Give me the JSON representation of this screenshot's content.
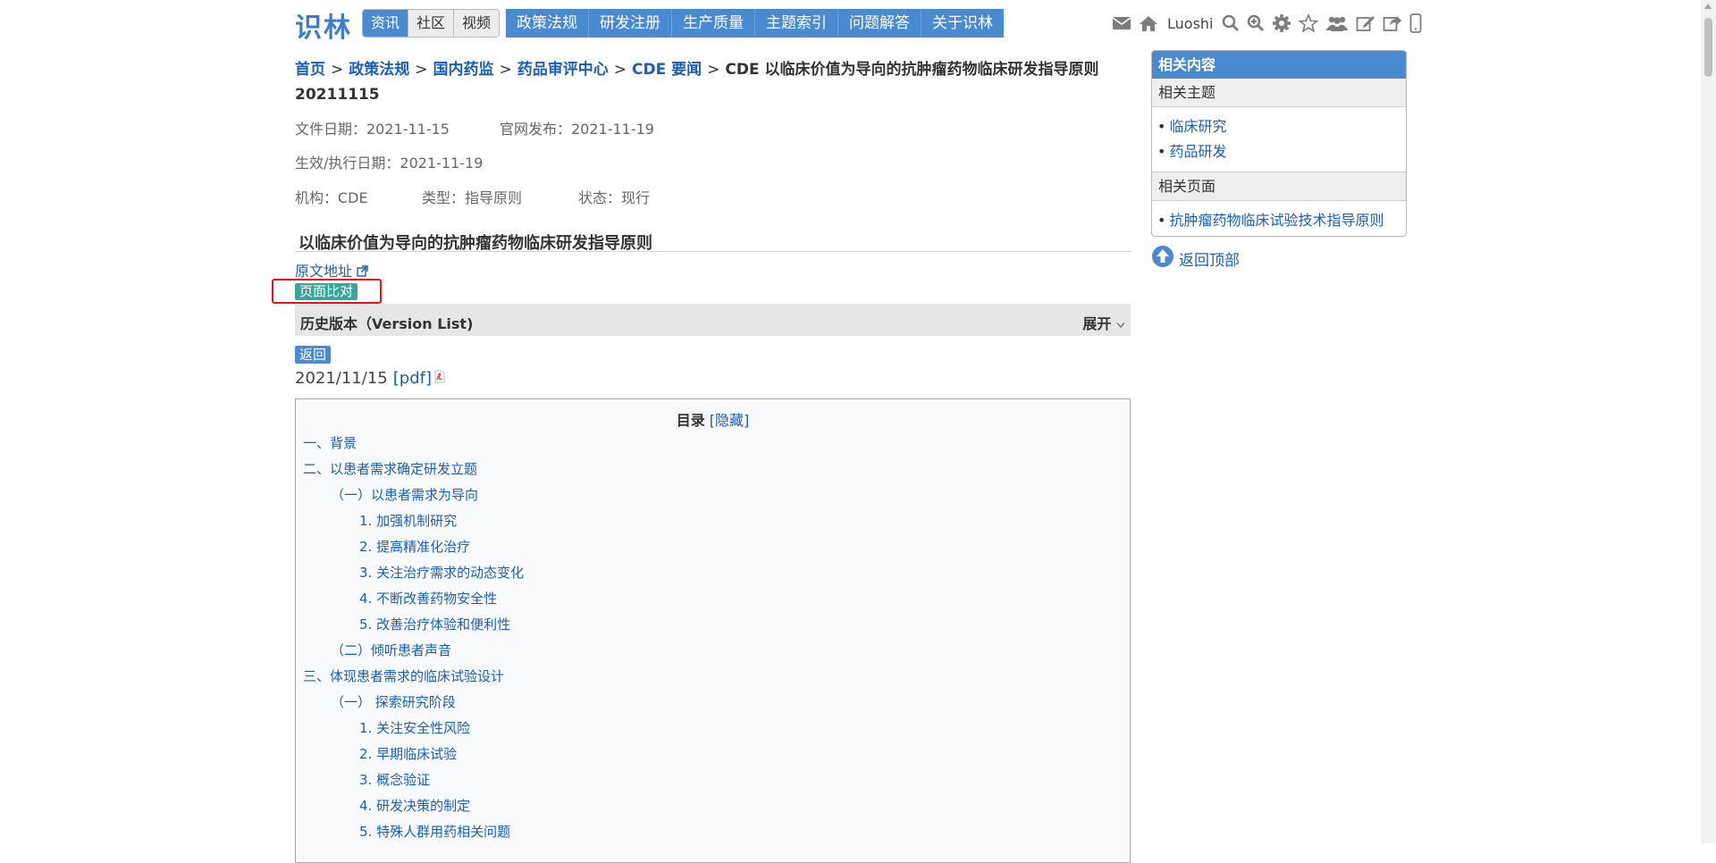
{
  "site": {
    "logo": "识林",
    "segments": [
      "资讯",
      "社区",
      "视频"
    ],
    "nav": [
      "政策法规",
      "研发注册",
      "生产质量",
      "主题索引",
      "问题解答",
      "关于识林"
    ],
    "user": "Luoshi"
  },
  "breadcrumb": {
    "items": [
      "首页",
      "政策法规",
      "国内药监",
      "药品审评中心",
      "CDE 要闻"
    ],
    "separator": ">",
    "current": "CDE 以临床价值为导向的抗肿瘤药物临床研发指导原则 20211115"
  },
  "meta": {
    "file_date": "文件日期：2021-11-15",
    "publish_date": "官网发布：2021-11-19",
    "effective_date": "生效/执行日期：2021-11-19",
    "org": "机构：CDE",
    "type": "类型：指导原则",
    "status": "状态：现行"
  },
  "doc": {
    "title": "以临床价值为导向的抗肿瘤药物临床研发指导原则",
    "origin_link": "原文地址",
    "compare_button": "页面比对"
  },
  "history": {
    "title": "历史版本（Version List)",
    "toggle": "展开"
  },
  "back_button": "返回",
  "version": {
    "date": "2021/11/15",
    "pdf": "[pdf]"
  },
  "toc": {
    "title": "目录",
    "hide": "[隐藏]",
    "items": [
      "一、背景",
      "二、以患者需求确定研发立题",
      "（一）以患者需求为导向",
      "1. 加强机制研究",
      "2. 提高精准化治疗",
      "3. 关注治疗需求的动态变化",
      "4. 不断改善药物安全性",
      "5. 改善治疗体验和便利性",
      "（二）倾听患者声音",
      "三、体现患者需求的临床试验设计",
      "（一） 探索研究阶段",
      "1. 关注安全性风险",
      "2. 早期临床试验",
      "3. 概念验证",
      "4. 研发决策的制定",
      "5. 特殊人群用药相关问题"
    ]
  },
  "sidebar": {
    "header": "相关内容",
    "topics_title": "相关主题",
    "topics": [
      "临床研究",
      "药品研发"
    ],
    "pages_title": "相关页面",
    "pages": [
      "抗肿瘤药物临床试验技术指导原则"
    ],
    "bullet": "•"
  },
  "back_to_top": "返回顶部",
  "colors": {
    "brand_blue": "#4a8ad0",
    "link_blue": "#1a5fb4",
    "compare_teal": "#3aa59a",
    "highlight_red": "#e11111"
  }
}
